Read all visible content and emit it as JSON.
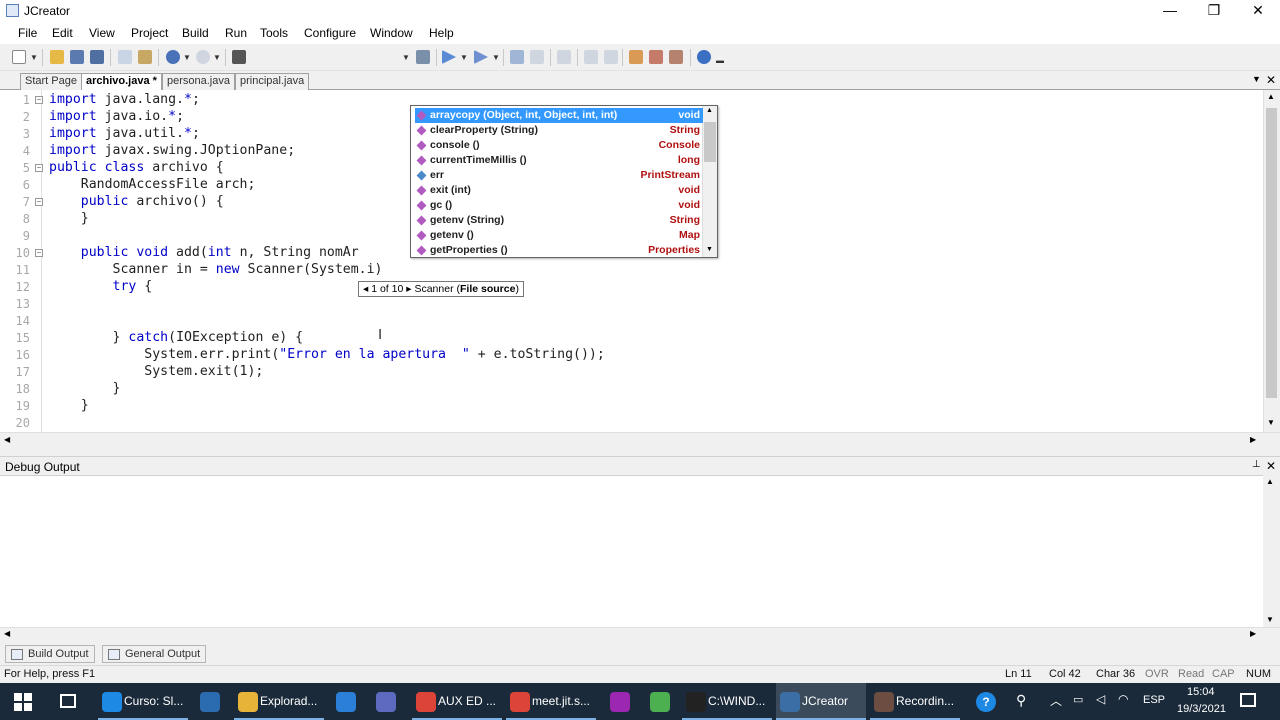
{
  "window": {
    "title": "JCreator",
    "minimize": "—",
    "restore": "❐",
    "close": "✕"
  },
  "menu": [
    "File",
    "Edit",
    "View",
    "Project",
    "Build",
    "Run",
    "Tools",
    "Configure",
    "Window",
    "Help"
  ],
  "tabs": [
    {
      "label": "Start Page",
      "active": false
    },
    {
      "label": "archivo.java *",
      "active": true
    },
    {
      "label": "persona.java",
      "active": false
    },
    {
      "label": "principal.java",
      "active": false
    }
  ],
  "editor": {
    "line_numbers": [
      "1",
      "2",
      "3",
      "4",
      "5",
      "6",
      "7",
      "8",
      "9",
      "10",
      "11",
      "12",
      "13",
      "14",
      "15",
      "16",
      "17",
      "18",
      "19",
      "20"
    ],
    "lines": [
      {
        "kw": "import",
        "rest": " java.lang.",
        "tail": "*",
        "end": ";"
      },
      {
        "kw": "import",
        "rest": " java.io.",
        "tail": "*",
        "end": ";"
      },
      {
        "kw": "import",
        "rest": " java.util.",
        "tail": "*",
        "end": ";"
      },
      {
        "kw": "import",
        "rest": " javax.swing.JOptionPane;",
        "tail": "",
        "end": ""
      },
      {
        "kw": "public class",
        "rest": " archivo {",
        "tail": "",
        "end": ""
      },
      {
        "kw": "    ",
        "rest": "RandomAccessFile arch;",
        "tail": "",
        "end": ""
      },
      {
        "kw": "    public",
        "rest": " archivo() {",
        "tail": "",
        "end": ""
      },
      {
        "kw": "    ",
        "rest": "}",
        "tail": "",
        "end": ""
      },
      {
        "kw": "",
        "rest": "",
        "tail": "",
        "end": ""
      },
      {
        "kw": "    public void",
        "rest": " add(",
        "tail": "int",
        "end": " n, String nomAr"
      },
      {
        "kw": "        ",
        "rest": "Scanner in = ",
        "tail": "new",
        "end": " Scanner(System.i)"
      },
      {
        "kw": "        try",
        "rest": " {",
        "tail": "",
        "end": ""
      },
      {
        "kw": "",
        "rest": "",
        "tail": "",
        "end": ""
      },
      {
        "kw": "",
        "rest": "",
        "tail": "",
        "end": ""
      },
      {
        "kw": "        ",
        "rest": "} ",
        "tail": "catch",
        "end": "(IOException e) {"
      },
      {
        "kw": "            ",
        "rest": "System.err.print(",
        "tail": "\"Error en la apertura  \"",
        "end": " + e.toString());"
      },
      {
        "kw": "            ",
        "rest": "System.exit(1);",
        "tail": "",
        "end": ""
      },
      {
        "kw": "        ",
        "rest": "}",
        "tail": "",
        "end": ""
      },
      {
        "kw": "    ",
        "rest": "}",
        "tail": "",
        "end": ""
      },
      {
        "kw": "",
        "rest": "",
        "tail": "",
        "end": ""
      }
    ]
  },
  "autocomplete": {
    "items": [
      {
        "label": "arraycopy (Object, int, Object, int, int)",
        "type": "void",
        "kind": "method",
        "selected": true
      },
      {
        "label": "clearProperty (String)",
        "type": "String",
        "kind": "method",
        "selected": false
      },
      {
        "label": "console ()",
        "type": "Console",
        "kind": "method",
        "selected": false
      },
      {
        "label": "currentTimeMillis ()",
        "type": "long",
        "kind": "method",
        "selected": false
      },
      {
        "label": "err",
        "type": "PrintStream",
        "kind": "field",
        "selected": false
      },
      {
        "label": "exit (int)",
        "type": "void",
        "kind": "method",
        "selected": false
      },
      {
        "label": "gc ()",
        "type": "void",
        "kind": "method",
        "selected": false
      },
      {
        "label": "getenv (String)",
        "type": "String",
        "kind": "method",
        "selected": false
      },
      {
        "label": "getenv ()",
        "type": "Map",
        "kind": "method",
        "selected": false
      },
      {
        "label": "getProperties ()",
        "type": "Properties",
        "kind": "method",
        "selected": false
      }
    ]
  },
  "tooltip": {
    "prev": "◂",
    "counter": "1 of 10",
    "next": "▸",
    "text": "Scanner (",
    "bold": "File source",
    "close": ")"
  },
  "debug": {
    "title": "Debug Output",
    "pin": "📌",
    "close": "✕"
  },
  "output_tabs": [
    "Build Output",
    "General Output"
  ],
  "status": {
    "help": "For Help, press F1",
    "line": "Ln 11",
    "col": "Col 42",
    "char": "Char 36",
    "ovr": "OVR",
    "read": "Read",
    "cap": "CAP",
    "num": "NUM"
  },
  "taskbar": {
    "items": [
      {
        "label": "Curso: Sl...",
        "color": "#1e88e5"
      },
      {
        "label": "",
        "color": "#2b6cb0"
      },
      {
        "label": "Explorad...",
        "color": "#e8b339"
      },
      {
        "label": "",
        "color": "#2b7fd6"
      },
      {
        "label": "",
        "color": "#5c6bc0"
      },
      {
        "label": "AUX ED ...",
        "color": "#db4437"
      },
      {
        "label": "meet.jit.s...",
        "color": "#db4437"
      },
      {
        "label": "",
        "color": "#9c27b0"
      },
      {
        "label": "",
        "color": "#4caf50"
      },
      {
        "label": "C:\\WIND...",
        "color": "#222222"
      },
      {
        "label": "JCreator",
        "color": "#3a6ea5"
      },
      {
        "label": "Recordin...",
        "color": "#6d4c41"
      }
    ],
    "lang": "ESP",
    "time": "15:04",
    "date": "19/3/2021"
  }
}
